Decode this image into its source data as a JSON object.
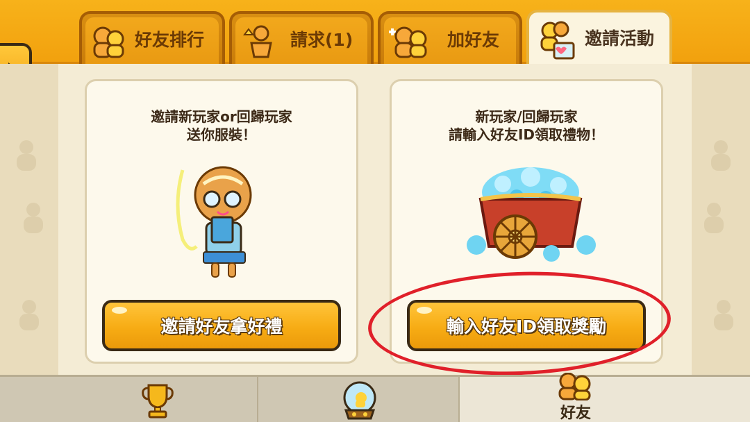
{
  "tabs": [
    {
      "label": "好友排行",
      "active": false
    },
    {
      "label": "請求(1)",
      "active": false
    },
    {
      "label": "加好友",
      "active": false
    },
    {
      "label": "邀請活動",
      "active": true
    }
  ],
  "cards": {
    "invite": {
      "line1": "邀請新玩家or回歸玩家",
      "line2": "送你服裝！",
      "button": "邀請好友拿好禮"
    },
    "redeem": {
      "line1": "新玩家/回歸玩家",
      "line2": "請輸入好友ID領取禮物！",
      "button": "輸入好友ID領取獎勵"
    }
  },
  "bottom_nav": {
    "items": [
      {
        "icon": "trophy-icon",
        "label": ""
      },
      {
        "icon": "snow-globe-icon",
        "label": ""
      },
      {
        "icon": "friends-icon",
        "label": "好友",
        "active": true
      }
    ]
  },
  "colors": {
    "header": "#f2a10e",
    "button": "#f7ac14",
    "annotation": "#e0202a"
  }
}
